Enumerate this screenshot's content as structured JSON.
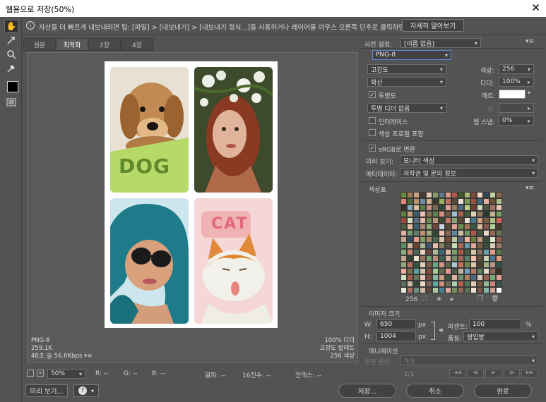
{
  "window": {
    "title": "웹용으로 저장(50%)",
    "close": "✕"
  },
  "tip": {
    "text": "자산을 더 빠르게 내보내려면 팁: [파일] > [내보내기] > [내보내기 형식...]을 사용하거나 레이어를 마우스 오른쪽 단추로 클릭하면 됩니다.",
    "learn_more": "자세히 알아보기"
  },
  "tabs": [
    {
      "label": "원본",
      "active": false
    },
    {
      "label": "최적화",
      "active": true
    },
    {
      "label": "2장",
      "active": false
    },
    {
      "label": "4장",
      "active": false
    }
  ],
  "preview": {
    "info_left": [
      "PNG-8",
      "259.1K",
      "48초 @ 56.6Kbps"
    ],
    "info_right": [
      "100% 디더",
      "고강도 팔레트",
      "256 색상"
    ],
    "photos": [
      {
        "name": "dog-photo",
        "caption": "DOG"
      },
      {
        "name": "woman-flowers-photo",
        "caption": ""
      },
      {
        "name": "blue-hair-woman-photo",
        "caption": ""
      },
      {
        "name": "cat-photo",
        "caption": "CAT"
      }
    ]
  },
  "bottom": {
    "zoom": "50%",
    "r": "R: --",
    "g": "G: --",
    "b": "B: --",
    "alpha": "알파: --",
    "hex": "16진수: --",
    "index": "인덱스: --",
    "preview_btn": "미리 보기...",
    "save": "저장...",
    "cancel": "취소",
    "done": "완료"
  },
  "settings": {
    "preset_label": "사전 설정:",
    "preset_value": "[이름 없음]",
    "format": "PNG-8",
    "reduction": "고강도",
    "colors_label": "색상:",
    "colors_value": "256",
    "dither_algo": "확산",
    "dither_label": "디더:",
    "dither_value": "100%",
    "transparency_label": "투명도",
    "transparency_checked": true,
    "matte_label": "매트:",
    "transparency_dither": "투명 디더 없음",
    "amount_label": "양:",
    "interlaced_label": "인터레이스",
    "interlaced_checked": false,
    "websnap_label": "웹 스냅:",
    "websnap_value": "0%",
    "embed_profile_label": "색상 프로필 포함",
    "embed_profile_checked": false,
    "srgb_label": "sRGB로 변환",
    "srgb_checked": true,
    "preview_label": "미리 보기:",
    "preview_value": "모니터 색상",
    "metadata_label": "메타데이터:",
    "metadata_value": "저작권 및 문의 정보"
  },
  "color_table": {
    "title": "색상표",
    "count": "256",
    "colors": [
      "#6b8a3c",
      "#9b7a5a",
      "#c9a083",
      "#4c3a2c",
      "#e5c7b3",
      "#8a9a6a",
      "#5c7a8a",
      "#d89a86",
      "#b45a4a",
      "#3e5a2c",
      "#a6b87a",
      "#7a4a3a",
      "#f0d8c8",
      "#2c4a5a",
      "#c8d0a0",
      "#8a6a4a",
      "#e08a7a",
      "#4a6a3a",
      "#b89070",
      "#6a8aa0",
      "#d0b090",
      "#3a3a2c",
      "#9ab060",
      "#c07060",
      "#5a4a3a",
      "#e8e0d0",
      "#7a9a50",
      "#a05040",
      "#406a7a",
      "#f0b0a0",
      "#6a5030",
      "#b0c090",
      "#3a2a20",
      "#88a8b8",
      "#d8c0a0",
      "#5a7a40",
      "#c89080",
      "#7a6a50",
      "#2a4a3a",
      "#e0a890",
      "#9a8060",
      "#506a80",
      "#b8d080",
      "#704030",
      "#d0d8c0",
      "#4a5a3a",
      "#a87060",
      "#e8c8b0",
      "#608040",
      "#c0a080",
      "#3a5a6a",
      "#f0c0b0",
      "#8a7050",
      "#5a8050",
      "#d89080",
      "#6a5a40",
      "#a0c0d0",
      "#b06050",
      "#40603a",
      "#e0d0b8",
      "#907860",
      "#2a3a2a",
      "#c8b090",
      "#7aa060",
      "#a04838",
      "#d8e0c0",
      "#5a7080",
      "#e8b8a0",
      "#6a8a50",
      "#b89878",
      "#3a4a30",
      "#c87868",
      "#8aa870",
      "#604838",
      "#f0e0d0",
      "#4a7a8a",
      "#d0a080",
      "#7a5a40",
      "#a8c080",
      "#d06858",
      "#506040",
      "#e0c0a0",
      "#386070",
      "#b08870",
      "#90b070",
      "#704838",
      "#c8d8e0",
      "#5a4830",
      "#e8a090",
      "#6a9050",
      "#a07858",
      "#3a5a40",
      "#d8b898",
      "#8a5848",
      "#b0d090",
      "#4a3828",
      "#e0b0a0",
      "#7a9a70",
      "#60806a",
      "#c09070",
      "#a0a880",
      "#304838",
      "#f0c8b8",
      "#8a6858",
      "#5a8a9a",
      "#d0c0a0",
      "#709860",
      "#b05848",
      "#405840",
      "#e8d8c0",
      "#986850",
      "#6a7a5a",
      "#c8a890",
      "#305060",
      "#e09888",
      "#80a060",
      "#a88868",
      "#4a6a50",
      "#d8c8b0",
      "#7a4838",
      "#b8c8a0",
      "#5a6a7a",
      "#f0b8a8",
      "#6a8040",
      "#c09880",
      "#3a4838",
      "#e0e8d0",
      "#906050",
      "#5a9060",
      "#d0b8a0",
      "#704030",
      "#a8b890",
      "#405868",
      "#e8c0b0",
      "#8a8060",
      "#5a5040",
      "#c8e0b0",
      "#b06858",
      "#6a9aa8",
      "#e0a898",
      "#7a6040",
      "#38503a",
      "#d8d0b8",
      "#a07868",
      "#88b080",
      "#c88878",
      "#506858",
      "#f0d0c0",
      "#6a4838",
      "#b0b890",
      "#3a6878",
      "#e0b8a0",
      "#78a068",
      "#a85848",
      "#485a40",
      "#d0c8a8",
      "#8a7060",
      "#60a0b0",
      "#e89888",
      "#5a7848",
      "#c0a890",
      "#304030",
      "#e8e0c8",
      "#987060",
      "#70a070",
      "#b89080",
      "#406050",
      "#d8b0a0",
      "#7a8a60",
      "#a06858",
      "#58806a",
      "#f0c0a8",
      "#605038",
      "#c8d0b0",
      "#4a7890",
      "#e0a080",
      "#90a878",
      "#b87060",
      "#385040",
      "#e8d0b8",
      "#806048",
      "#68a888",
      "#d09888",
      "#5a6848",
      "#b0c8d0",
      "#c87058",
      "#708a50",
      "#e0c8b0",
      "#4a4030",
      "#a0b880",
      "#c09888",
      "#305848",
      "#f0b0a0",
      "#7a7050",
      "#58a0a0",
      "#d8c0a8",
      "#8a4838",
      "#a8c898",
      "#606a50",
      "#e89890",
      "#4a5a48",
      "#c0b098",
      "#70a0c0",
      "#b87868",
      "#5a8058",
      "#e8d8c8",
      "#906858",
      "#3a3020",
      "#d0e0c0",
      "#a06050",
      "#607858",
      "#f0c8c0",
      "#785040",
      "#88b8a0",
      "#c8a088",
      "#405040",
      "#e0b0a0",
      "#6a9070",
      "#b08060",
      "#4a6878",
      "#d8c8b8",
      "#986050",
      "#7aa878",
      "#e0a090",
      "#5a7060",
      "#c8b8a0",
      "#384838",
      "#f0d8c8",
      "#806050",
      "#60a8a0",
      "#d09080",
      "#6a7050",
      "#a8d0b0",
      "#b86050",
      "#507858",
      "#e8c8b8",
      "#705838",
      "#98b890",
      "#c88878",
      "#3a5850",
      "#e8e8e0",
      "#a87060",
      "#68907a",
      "#d8b8a8",
      "#604838",
      "#b0c8a0",
      "#4a8090",
      "#e0a898",
      "#789060",
      "#986858",
      "#587050",
      "#f0e0d8",
      "#7a5848",
      "#80b8a8",
      "#d0a090",
      "#ffffff"
    ]
  },
  "image_size": {
    "title": "이미지 크기",
    "w_label": "W:",
    "w_value": "650",
    "h_label": "H:",
    "h_value": "1004",
    "unit": "px",
    "percent_label": "퍼센트:",
    "percent_value": "100",
    "percent_unit": "%",
    "quality_label": "품질:",
    "quality_value": "쌍입방"
  },
  "animation": {
    "title": "애니메이션",
    "loop_label": "루핑 옵션:",
    "loop_value": "계속",
    "frame": "1/1"
  }
}
